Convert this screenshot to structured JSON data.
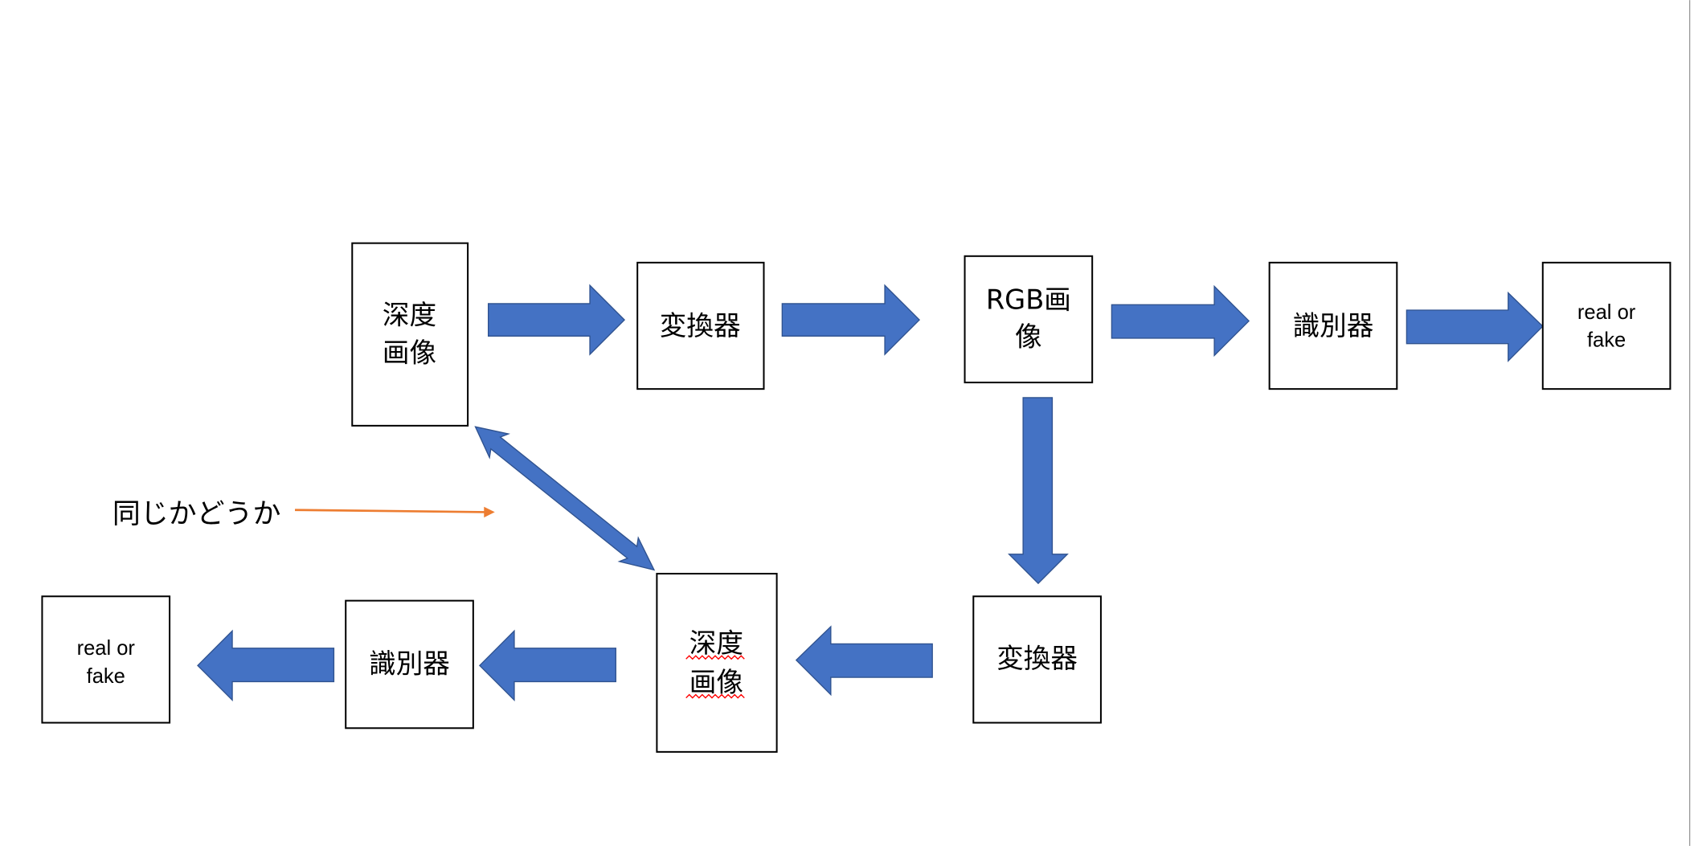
{
  "colors": {
    "arrow_fill": "#4472C4",
    "arrow_stroke": "#2F528F",
    "note_arrow": "#ED7D31",
    "spellcheck": "#FF0000"
  },
  "nodes": {
    "depth1": [
      "深度",
      "画像"
    ],
    "converter1": "変換器",
    "rgb": [
      "RGB画",
      "像"
    ],
    "discriminator1": "識別器",
    "output1": [
      "real or",
      "fake"
    ],
    "converter2": "変換器",
    "depth2": [
      "深度",
      "画像"
    ],
    "discriminator2": "識別器",
    "output2": [
      "real or",
      "fake"
    ]
  },
  "note": "同じかどうか"
}
